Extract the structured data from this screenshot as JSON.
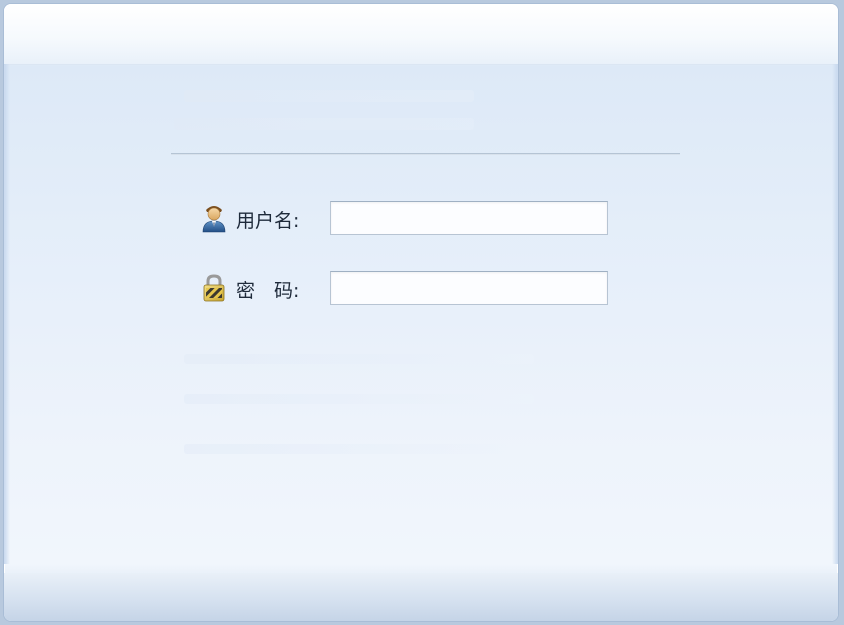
{
  "form": {
    "username": {
      "label": "用户名:",
      "value": "",
      "icon": "user-icon"
    },
    "password": {
      "label": "密　码:",
      "value": "",
      "icon": "lock-icon"
    }
  }
}
